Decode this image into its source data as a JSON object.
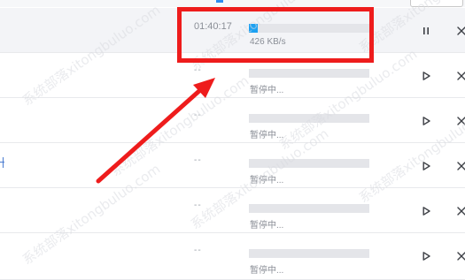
{
  "downloads": [
    {
      "time": "01:40:17",
      "progress": 0.07,
      "status": "426 KB/s",
      "action": "pause",
      "active": true
    },
    {
      "time": "--",
      "progress": 0,
      "status": "暂停中...",
      "action": "play",
      "active": false
    },
    {
      "time": "--",
      "progress": 0,
      "status": "暂停中...",
      "action": "play",
      "active": false
    },
    {
      "time": "--",
      "progress": 0,
      "status": "暂停中...",
      "action": "play",
      "active": false
    },
    {
      "time": "--",
      "progress": 0,
      "status": "暂停中...",
      "action": "play",
      "active": false
    },
    {
      "time": "--",
      "progress": 0,
      "status": "暂停中...",
      "action": "play",
      "active": false
    }
  ],
  "watermark_text": "系统部落xitongbuluo.com",
  "colors": {
    "progress_fill": "#1da1f2",
    "annotation_red": "#ee1c1c",
    "active_row_bg": "#f3f4f7"
  },
  "icons": {
    "pause": "pause-icon",
    "play": "play-icon",
    "close": "close-icon"
  }
}
